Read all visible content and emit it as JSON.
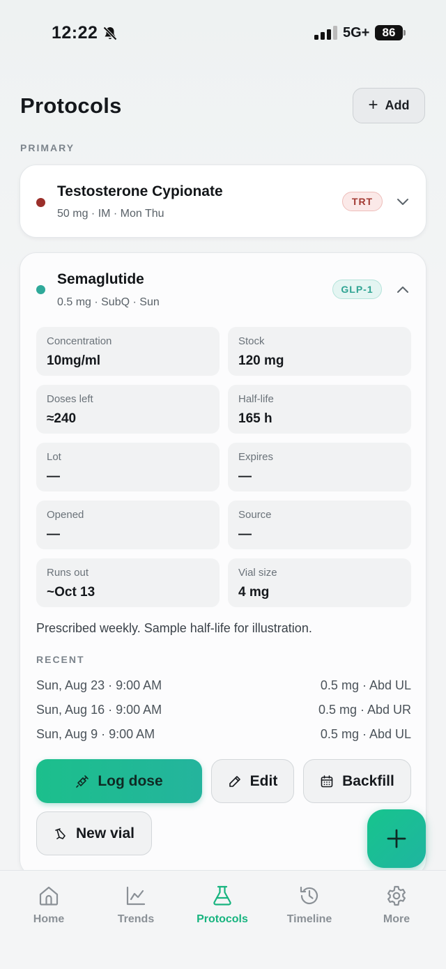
{
  "status_bar": {
    "time": "12:22",
    "network": "5G+",
    "battery": "86"
  },
  "header": {
    "title": "Protocols",
    "add_label": "Add"
  },
  "section": {
    "primary_label": "PRIMARY"
  },
  "protocols": [
    {
      "name": "Testosterone Cypionate",
      "details": "50 mg · IM · Mon Thu",
      "tag": "TRT",
      "dot_color": "#9b2f2a",
      "expanded": false
    },
    {
      "name": "Semaglutide",
      "details": "0.5 mg · SubQ · Sun",
      "tag": "GLP-1",
      "dot_color": "#2fa99a",
      "expanded": true,
      "fields": [
        {
          "label": "Concentration",
          "value": "10mg/ml"
        },
        {
          "label": "Stock",
          "value": "120 mg"
        },
        {
          "label": "Doses left",
          "value": "≈240"
        },
        {
          "label": "Half-life",
          "value": "165 h"
        },
        {
          "label": "Lot",
          "value": "—"
        },
        {
          "label": "Expires",
          "value": "—"
        },
        {
          "label": "Opened",
          "value": "—"
        },
        {
          "label": "Source",
          "value": "—"
        },
        {
          "label": "Runs out",
          "value": "~Oct 13"
        },
        {
          "label": "Vial size",
          "value": "4 mg"
        }
      ],
      "note": "Prescribed weekly. Sample half-life for illustration.",
      "recent_label": "RECENT",
      "recent": [
        {
          "date": "Sun, Aug 23 · 9:00 AM",
          "dose": "0.5 mg · Abd UL"
        },
        {
          "date": "Sun, Aug 16 · 9:00 AM",
          "dose": "0.5 mg · Abd UR"
        },
        {
          "date": "Sun, Aug 9 · 9:00 AM",
          "dose": "0.5 mg · Abd UL"
        }
      ],
      "actions": {
        "log_dose": "Log dose",
        "edit": "Edit",
        "backfill": "Backfill",
        "new_vial": "New vial"
      }
    }
  ],
  "tabs": [
    {
      "label": "Home",
      "icon": "home-icon"
    },
    {
      "label": "Trends",
      "icon": "trends-icon"
    },
    {
      "label": "Protocols",
      "icon": "flask-icon",
      "active": true
    },
    {
      "label": "Timeline",
      "icon": "history-icon"
    },
    {
      "label": "More",
      "icon": "gear-icon"
    }
  ],
  "colors": {
    "accent": "#17b47f",
    "trt": "#a23a33",
    "glp": "#2ea392"
  }
}
